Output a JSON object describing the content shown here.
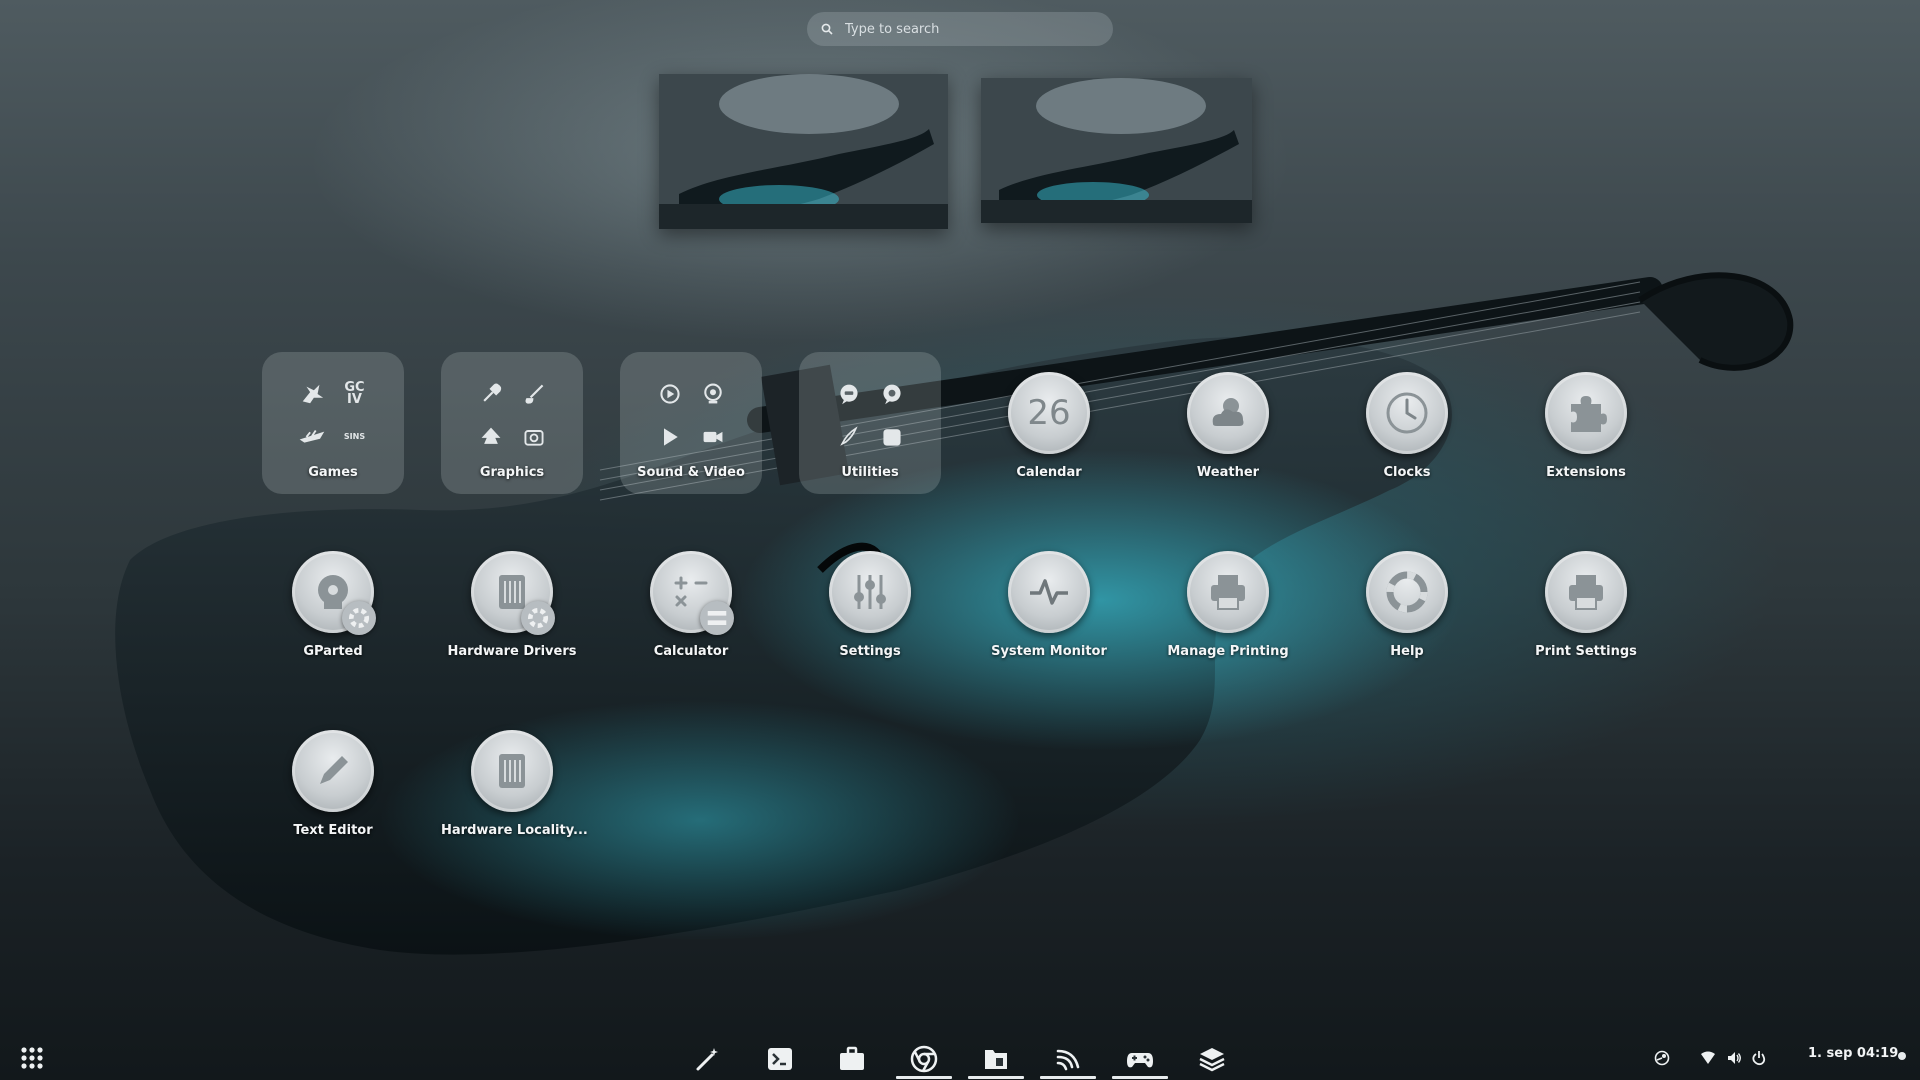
{
  "search": {
    "placeholder": "Type to search",
    "icon": "search-icon"
  },
  "workspaces": [
    {
      "name": "workspace-1",
      "active": true
    },
    {
      "name": "workspace-2",
      "active": false
    }
  ],
  "app_grid": {
    "folders": [
      {
        "label": "Games",
        "icons": [
          "dragon-game-icon",
          "gc-iv-game-icon",
          "ship-game-icon",
          "sins-game-icon"
        ]
      },
      {
        "label": "Graphics",
        "icons": [
          "color-picker-icon",
          "brush-icon",
          "inkscape-icon",
          "screenshot-icon"
        ]
      },
      {
        "label": "Sound & Video",
        "icons": [
          "play-circle-icon",
          "webcam-icon",
          "play-icon",
          "video-camera-icon"
        ]
      },
      {
        "label": "Utilities",
        "icons": [
          "chat-icon",
          "chat-icon",
          "pen-icon",
          "archive-icon"
        ]
      }
    ],
    "apps": [
      {
        "label": "Calendar",
        "icon": "calendar-icon",
        "text": "26"
      },
      {
        "label": "Weather",
        "icon": "weather-icon"
      },
      {
        "label": "Clocks",
        "icon": "clock-icon"
      },
      {
        "label": "Extensions",
        "icon": "puzzle-icon"
      },
      {
        "label": "GParted",
        "icon": "gparted-icon"
      },
      {
        "label": "Hardware Drivers",
        "icon": "hardware-drivers-icon"
      },
      {
        "label": "Calculator",
        "icon": "calculator-icon"
      },
      {
        "label": "Settings",
        "icon": "settings-sliders-icon"
      },
      {
        "label": "System Monitor",
        "icon": "system-monitor-icon"
      },
      {
        "label": "Manage Printing",
        "icon": "printer-icon"
      },
      {
        "label": "Help",
        "icon": "lifebuoy-icon"
      },
      {
        "label": "Print Settings",
        "icon": "printer-icon"
      },
      {
        "label": "Text Editor",
        "icon": "pencil-icon"
      },
      {
        "label": "Hardware Locality...",
        "icon": "hardware-locality-icon"
      }
    ]
  },
  "dock": {
    "items": [
      {
        "name": "magic-wand-icon",
        "running": false
      },
      {
        "name": "terminal-icon",
        "running": false
      },
      {
        "name": "briefcase-icon",
        "running": false
      },
      {
        "name": "chrome-icon",
        "running": true
      },
      {
        "name": "files-icon",
        "running": true
      },
      {
        "name": "feed-icon",
        "running": true
      },
      {
        "name": "gamepad-icon",
        "running": true
      },
      {
        "name": "layers-icon",
        "running": false
      }
    ]
  },
  "panel": {
    "show_apps_icon": "app-grid-icon",
    "tray": [
      "steam-icon",
      "wifi-icon",
      "volume-icon",
      "power-icon"
    ],
    "clock": "1. sep  04:19"
  },
  "colors": {
    "accent": "#e8ecee",
    "folder_bg": "rgba(210,218,222,0.2)",
    "icon_circle": "#c8cdd0"
  }
}
